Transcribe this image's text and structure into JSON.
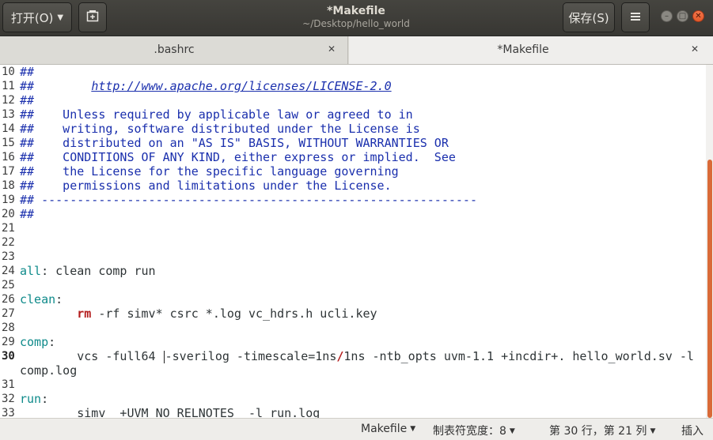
{
  "header": {
    "open_label": "打开(O)",
    "title": "*Makefile",
    "subtitle": "~/Desktop/hello_world",
    "save_label": "保存(S)"
  },
  "icons": {
    "new_tab": "new-tab-icon",
    "menu": "hamburger-menu-icon",
    "minimize": "minimize-icon",
    "maximize": "maximize-icon",
    "close": "close-icon"
  },
  "tabs": [
    {
      "label": ".bashrc",
      "active": false
    },
    {
      "label": "*Makefile",
      "active": true
    }
  ],
  "editor": {
    "current_line": "30",
    "lines": [
      {
        "n": "10",
        "parts": [
          {
            "t": "##",
            "c": "cmt"
          }
        ]
      },
      {
        "n": "11",
        "parts": [
          {
            "t": "##        ",
            "c": "cmt"
          },
          {
            "t": "http://www.apache.org/licenses/LICENSE-2.0",
            "c": "url"
          }
        ]
      },
      {
        "n": "12",
        "parts": [
          {
            "t": "##",
            "c": "cmt"
          }
        ]
      },
      {
        "n": "13",
        "parts": [
          {
            "t": "##    Unless required by applicable law or agreed to in",
            "c": "cmt"
          }
        ]
      },
      {
        "n": "14",
        "parts": [
          {
            "t": "##    writing, software distributed under the License is",
            "c": "cmt"
          }
        ]
      },
      {
        "n": "15",
        "parts": [
          {
            "t": "##    distributed on an \"AS IS\" BASIS, WITHOUT WARRANTIES OR",
            "c": "cmt"
          }
        ]
      },
      {
        "n": "16",
        "parts": [
          {
            "t": "##    CONDITIONS OF ANY KIND, either express or implied.  See",
            "c": "cmt"
          }
        ]
      },
      {
        "n": "17",
        "parts": [
          {
            "t": "##    the License for the specific language governing",
            "c": "cmt"
          }
        ]
      },
      {
        "n": "18",
        "parts": [
          {
            "t": "##    permissions and limitations under the License.",
            "c": "cmt"
          }
        ]
      },
      {
        "n": "19",
        "parts": [
          {
            "t": "## -------------------------------------------------------------",
            "c": "cmt"
          }
        ]
      },
      {
        "n": "20",
        "parts": [
          {
            "t": "##",
            "c": "cmt"
          }
        ]
      },
      {
        "n": "21",
        "parts": []
      },
      {
        "n": "22",
        "parts": []
      },
      {
        "n": "23",
        "parts": []
      },
      {
        "n": "24",
        "parts": [
          {
            "t": "all",
            "c": "target"
          },
          {
            "t": ": clean comp run",
            "c": ""
          }
        ]
      },
      {
        "n": "25",
        "parts": []
      },
      {
        "n": "26",
        "parts": [
          {
            "t": "clean",
            "c": "target"
          },
          {
            "t": ":",
            "c": ""
          }
        ]
      },
      {
        "n": "27",
        "parts": [
          {
            "t": "        ",
            "c": ""
          },
          {
            "t": "rm",
            "c": "kw"
          },
          {
            "t": " -rf simv* csrc *.log vc_hdrs.h ucli.key",
            "c": ""
          }
        ]
      },
      {
        "n": "28",
        "parts": []
      },
      {
        "n": "29",
        "parts": [
          {
            "t": "comp",
            "c": "target"
          },
          {
            "t": ":",
            "c": ""
          }
        ]
      },
      {
        "n": "30",
        "parts": [
          {
            "t": "        vcs -full64 ",
            "c": ""
          },
          {
            "t": "",
            "c": "caret"
          },
          {
            "t": "-sverilog -timescale=1ns",
            "c": ""
          },
          {
            "t": "/",
            "c": "kw"
          },
          {
            "t": "1ns -ntb_opts uvm-1.1 +incdir+. hello_world.sv -l",
            "c": ""
          }
        ]
      },
      {
        "n": "",
        "parts": [
          {
            "t": "comp.log",
            "c": ""
          }
        ]
      },
      {
        "n": "31",
        "parts": []
      },
      {
        "n": "32",
        "parts": [
          {
            "t": "run",
            "c": "target"
          },
          {
            "t": ":",
            "c": ""
          }
        ]
      },
      {
        "n": "33",
        "parts": [
          {
            "t": "        simv  +UVM_NO_RELNOTES  -l run.log",
            "c": ""
          }
        ]
      }
    ]
  },
  "statusbar": {
    "language": "Makefile",
    "tab_width": "制表符宽度：8",
    "position": "第 30 行，第 21 列",
    "mode": "插入"
  }
}
